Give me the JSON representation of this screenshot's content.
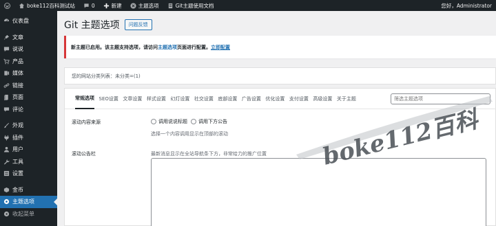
{
  "adminbar": {
    "site_name": "boke112百科测试站",
    "comments_count": "0",
    "new_label": "新建",
    "theme_options_label": "主题选项",
    "docs_label": "Git主题使用文档",
    "greeting": "您好，Administrator"
  },
  "sidebar": {
    "items": [
      {
        "label": "仪表盘",
        "icon": "dashboard-icon"
      },
      {
        "label": "文章",
        "icon": "pin-icon"
      },
      {
        "label": "说说",
        "icon": "comment-icon"
      },
      {
        "label": "产品",
        "icon": "cart-icon"
      },
      {
        "label": "媒体",
        "icon": "media-icon"
      },
      {
        "label": "链接",
        "icon": "link-icon"
      },
      {
        "label": "页面",
        "icon": "page-icon"
      },
      {
        "label": "评论",
        "icon": "comments-icon"
      },
      {
        "label": "外观",
        "icon": "brush-icon"
      },
      {
        "label": "插件",
        "icon": "plugin-icon"
      },
      {
        "label": "用户",
        "icon": "users-icon"
      },
      {
        "label": "工具",
        "icon": "wrench-icon"
      },
      {
        "label": "设置",
        "icon": "settings-icon"
      },
      {
        "label": "金币",
        "icon": "coin-icon"
      },
      {
        "label": "主题选项",
        "icon": "gear-icon"
      },
      {
        "label": "收起菜单",
        "icon": "collapse-icon"
      }
    ]
  },
  "page": {
    "title": "Git 主题选项",
    "feedback_button": "问题反馈"
  },
  "notice": {
    "text_before": "新主题已启用。该主题支持选项，请访问",
    "link1": "主题选项",
    "text_middle": "页面进行配置。",
    "link2": "立即配置"
  },
  "category_line": "您的网站分类列表：未分类=(1)",
  "tabs": [
    "常规选项",
    "SEO设置",
    "文章设置",
    "样式设置",
    "幻灯设置",
    "社交设置",
    "底部设置",
    "广告设置",
    "优化设置",
    "支付设置",
    "高级设置",
    "关于主题"
  ],
  "tab_search_placeholder": "筛选主题选项",
  "settings": {
    "scroll_source_label": "滚动内容来源",
    "radio1": "调用说说标题",
    "radio2": "调用下方公告",
    "scroll_source_help": "选择一个内容调用显示在顶部的滚动",
    "notice_bar_label": "滚动公告栏",
    "notice_bar_help": "最新消息显示在全站导航条下方，非常给力的推广位置"
  },
  "watermark": "boke112百科",
  "colors": {
    "admin_bar": "#1d2327",
    "accent": "#2271b1",
    "notice_border": "#d63638"
  }
}
